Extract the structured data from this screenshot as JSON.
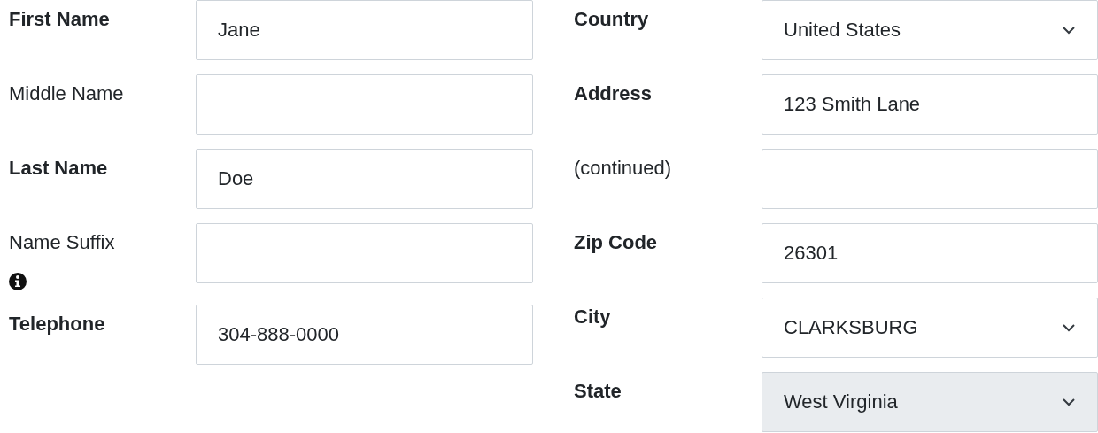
{
  "left_fields": [
    {
      "label": "First Name",
      "required": true,
      "kind": "text",
      "value": "Jane"
    },
    {
      "label": "Middle Name",
      "required": false,
      "kind": "text"
    },
    {
      "label": "Last Name",
      "required": true,
      "kind": "text",
      "value": "Doe"
    },
    {
      "label": "Name Suffix",
      "required": false,
      "kind": "text",
      "info": true
    },
    {
      "label": "Telephone",
      "required": true,
      "kind": "text",
      "value": "304-888-0000"
    }
  ],
  "right_fields": [
    {
      "label": "Country",
      "required": true,
      "kind": "select",
      "value": "United States",
      "disabled": false
    },
    {
      "label": "Address",
      "required": true,
      "kind": "text",
      "value": "123 Smith Lane"
    },
    {
      "label": "(continued)",
      "required": false,
      "kind": "text"
    },
    {
      "label": "Zip Code",
      "required": true,
      "kind": "text",
      "value": "26301"
    },
    {
      "label": "City",
      "required": true,
      "kind": "select",
      "value": "CLARKSBURG",
      "disabled": false
    },
    {
      "label": "State",
      "required": true,
      "kind": "select",
      "value": "West Virginia",
      "disabled": true
    }
  ]
}
